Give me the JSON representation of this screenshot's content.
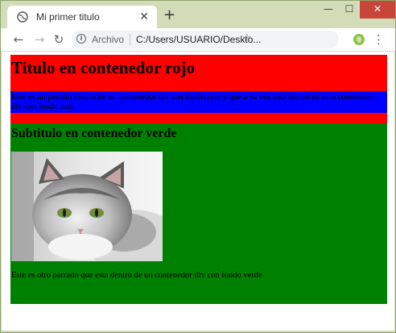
{
  "browser": {
    "tab_title": "Mi primer titulo",
    "tab_close": "✕",
    "new_tab": "+",
    "window_controls": {
      "minimize": "—",
      "maximize": "☐",
      "close": "✕"
    },
    "nav": {
      "back": "←",
      "forward": "→",
      "reload": "↻"
    },
    "omnibox": {
      "info": "i",
      "scheme_label": "Archivo",
      "url": "C:/Users/USUARIO/Deskto...",
      "star": "☆"
    },
    "menu": "⋮",
    "accent": "#8bc34a"
  },
  "page": {
    "red_box": {
      "heading": "Titulo en contenedor rojo",
      "color": "#ff0000",
      "blue_box": {
        "text": "Este es un párrafo dentro de un contenedor div con fondo rojo y que a su vez está dentro de otro contenedor div con fondo azul",
        "color": "#0000ff"
      }
    },
    "green_box": {
      "heading": "Subtitulo en contenedor verde",
      "color": "#008000",
      "image_icon": "cat-photo",
      "paragraph": "Este es otro parrado que esta dentro de un contenedor div con fondo verde"
    }
  }
}
